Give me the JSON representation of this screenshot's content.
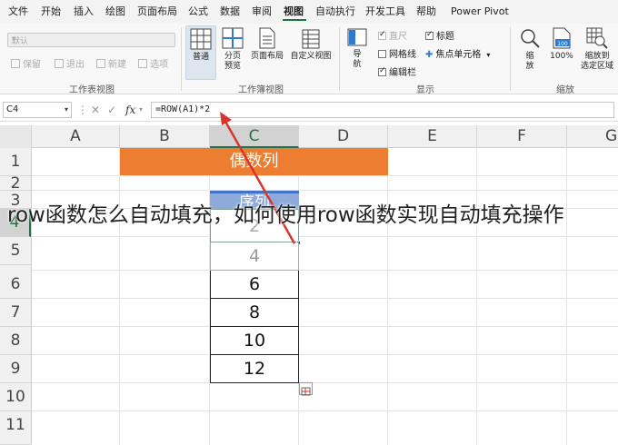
{
  "menu": {
    "items": [
      "文件",
      "开始",
      "插入",
      "绘图",
      "页面布局",
      "公式",
      "数据",
      "审阅",
      "视图",
      "自动执行",
      "开发工具",
      "帮助",
      "Power Pivot"
    ],
    "active": "视图"
  },
  "ribbon": {
    "sheet_view": {
      "combo_value": "默认",
      "buttons": [
        "保留",
        "退出",
        "新建",
        "选项"
      ],
      "label": "工作表视图"
    },
    "workbook_views": {
      "normal": "普通",
      "page_break_line1": "分页",
      "page_break_line2": "预览",
      "page_layout": "页面布局",
      "custom_view": "自定义视图",
      "label": "工作簿视图"
    },
    "show": {
      "nav_line1": "导",
      "nav_line2": "航",
      "ruler": "直尺",
      "headings": "标题",
      "gridlines": "网格线",
      "focus_cell": "焦点单元格",
      "formula_bar": "编辑栏",
      "label": "显示"
    },
    "zoom": {
      "zoom_line1": "缩",
      "zoom_line2": "放",
      "pct": "100%",
      "badge": "100",
      "zoom_sel_line1": "缩放到",
      "zoom_sel_line2": "选定区域",
      "label": "缩放"
    }
  },
  "formula_bar": {
    "name_box": "C4",
    "fx": "fx",
    "formula": "=ROW(A1)*2"
  },
  "grid": {
    "columns": [
      "A",
      "B",
      "C",
      "D",
      "E",
      "F",
      "G"
    ],
    "rows": [
      "1",
      "2",
      "3",
      "4",
      "5",
      "6",
      "7",
      "8",
      "9",
      "10",
      "11"
    ],
    "banner": "偶数列",
    "seq_header": "序列",
    "values": [
      "2",
      "4",
      "6",
      "8",
      "10",
      "12"
    ]
  },
  "caption": "row函数怎么自动填充，如何使用row函数实现自动填充操作",
  "colors": {
    "accent": "#217346",
    "banner": "#ed7d31",
    "seq_header": "#8eaadb",
    "arrow": "#d9342b"
  }
}
